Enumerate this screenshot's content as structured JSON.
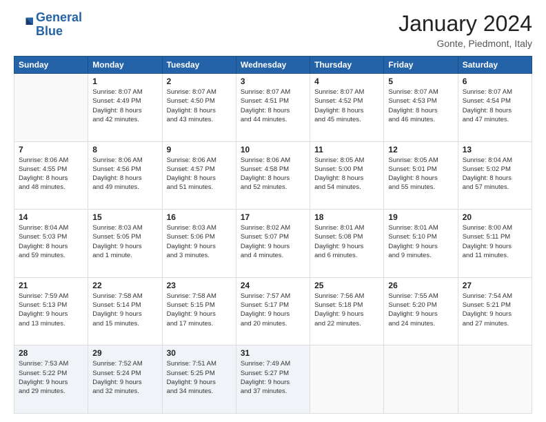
{
  "logo": {
    "line1": "General",
    "line2": "Blue"
  },
  "header": {
    "month": "January 2024",
    "location": "Gonte, Piedmont, Italy"
  },
  "weekdays": [
    "Sunday",
    "Monday",
    "Tuesday",
    "Wednesday",
    "Thursday",
    "Friday",
    "Saturday"
  ],
  "weeks": [
    [
      {
        "day": "",
        "info": ""
      },
      {
        "day": "1",
        "info": "Sunrise: 8:07 AM\nSunset: 4:49 PM\nDaylight: 8 hours\nand 42 minutes."
      },
      {
        "day": "2",
        "info": "Sunrise: 8:07 AM\nSunset: 4:50 PM\nDaylight: 8 hours\nand 43 minutes."
      },
      {
        "day": "3",
        "info": "Sunrise: 8:07 AM\nSunset: 4:51 PM\nDaylight: 8 hours\nand 44 minutes."
      },
      {
        "day": "4",
        "info": "Sunrise: 8:07 AM\nSunset: 4:52 PM\nDaylight: 8 hours\nand 45 minutes."
      },
      {
        "day": "5",
        "info": "Sunrise: 8:07 AM\nSunset: 4:53 PM\nDaylight: 8 hours\nand 46 minutes."
      },
      {
        "day": "6",
        "info": "Sunrise: 8:07 AM\nSunset: 4:54 PM\nDaylight: 8 hours\nand 47 minutes."
      }
    ],
    [
      {
        "day": "7",
        "info": "Sunrise: 8:06 AM\nSunset: 4:55 PM\nDaylight: 8 hours\nand 48 minutes."
      },
      {
        "day": "8",
        "info": "Sunrise: 8:06 AM\nSunset: 4:56 PM\nDaylight: 8 hours\nand 49 minutes."
      },
      {
        "day": "9",
        "info": "Sunrise: 8:06 AM\nSunset: 4:57 PM\nDaylight: 8 hours\nand 51 minutes."
      },
      {
        "day": "10",
        "info": "Sunrise: 8:06 AM\nSunset: 4:58 PM\nDaylight: 8 hours\nand 52 minutes."
      },
      {
        "day": "11",
        "info": "Sunrise: 8:05 AM\nSunset: 5:00 PM\nDaylight: 8 hours\nand 54 minutes."
      },
      {
        "day": "12",
        "info": "Sunrise: 8:05 AM\nSunset: 5:01 PM\nDaylight: 8 hours\nand 55 minutes."
      },
      {
        "day": "13",
        "info": "Sunrise: 8:04 AM\nSunset: 5:02 PM\nDaylight: 8 hours\nand 57 minutes."
      }
    ],
    [
      {
        "day": "14",
        "info": "Sunrise: 8:04 AM\nSunset: 5:03 PM\nDaylight: 8 hours\nand 59 minutes."
      },
      {
        "day": "15",
        "info": "Sunrise: 8:03 AM\nSunset: 5:05 PM\nDaylight: 9 hours\nand 1 minute."
      },
      {
        "day": "16",
        "info": "Sunrise: 8:03 AM\nSunset: 5:06 PM\nDaylight: 9 hours\nand 3 minutes."
      },
      {
        "day": "17",
        "info": "Sunrise: 8:02 AM\nSunset: 5:07 PM\nDaylight: 9 hours\nand 4 minutes."
      },
      {
        "day": "18",
        "info": "Sunrise: 8:01 AM\nSunset: 5:08 PM\nDaylight: 9 hours\nand 6 minutes."
      },
      {
        "day": "19",
        "info": "Sunrise: 8:01 AM\nSunset: 5:10 PM\nDaylight: 9 hours\nand 9 minutes."
      },
      {
        "day": "20",
        "info": "Sunrise: 8:00 AM\nSunset: 5:11 PM\nDaylight: 9 hours\nand 11 minutes."
      }
    ],
    [
      {
        "day": "21",
        "info": "Sunrise: 7:59 AM\nSunset: 5:13 PM\nDaylight: 9 hours\nand 13 minutes."
      },
      {
        "day": "22",
        "info": "Sunrise: 7:58 AM\nSunset: 5:14 PM\nDaylight: 9 hours\nand 15 minutes."
      },
      {
        "day": "23",
        "info": "Sunrise: 7:58 AM\nSunset: 5:15 PM\nDaylight: 9 hours\nand 17 minutes."
      },
      {
        "day": "24",
        "info": "Sunrise: 7:57 AM\nSunset: 5:17 PM\nDaylight: 9 hours\nand 20 minutes."
      },
      {
        "day": "25",
        "info": "Sunrise: 7:56 AM\nSunset: 5:18 PM\nDaylight: 9 hours\nand 22 minutes."
      },
      {
        "day": "26",
        "info": "Sunrise: 7:55 AM\nSunset: 5:20 PM\nDaylight: 9 hours\nand 24 minutes."
      },
      {
        "day": "27",
        "info": "Sunrise: 7:54 AM\nSunset: 5:21 PM\nDaylight: 9 hours\nand 27 minutes."
      }
    ],
    [
      {
        "day": "28",
        "info": "Sunrise: 7:53 AM\nSunset: 5:22 PM\nDaylight: 9 hours\nand 29 minutes."
      },
      {
        "day": "29",
        "info": "Sunrise: 7:52 AM\nSunset: 5:24 PM\nDaylight: 9 hours\nand 32 minutes."
      },
      {
        "day": "30",
        "info": "Sunrise: 7:51 AM\nSunset: 5:25 PM\nDaylight: 9 hours\nand 34 minutes."
      },
      {
        "day": "31",
        "info": "Sunrise: 7:49 AM\nSunset: 5:27 PM\nDaylight: 9 hours\nand 37 minutes."
      },
      {
        "day": "",
        "info": ""
      },
      {
        "day": "",
        "info": ""
      },
      {
        "day": "",
        "info": ""
      }
    ]
  ]
}
